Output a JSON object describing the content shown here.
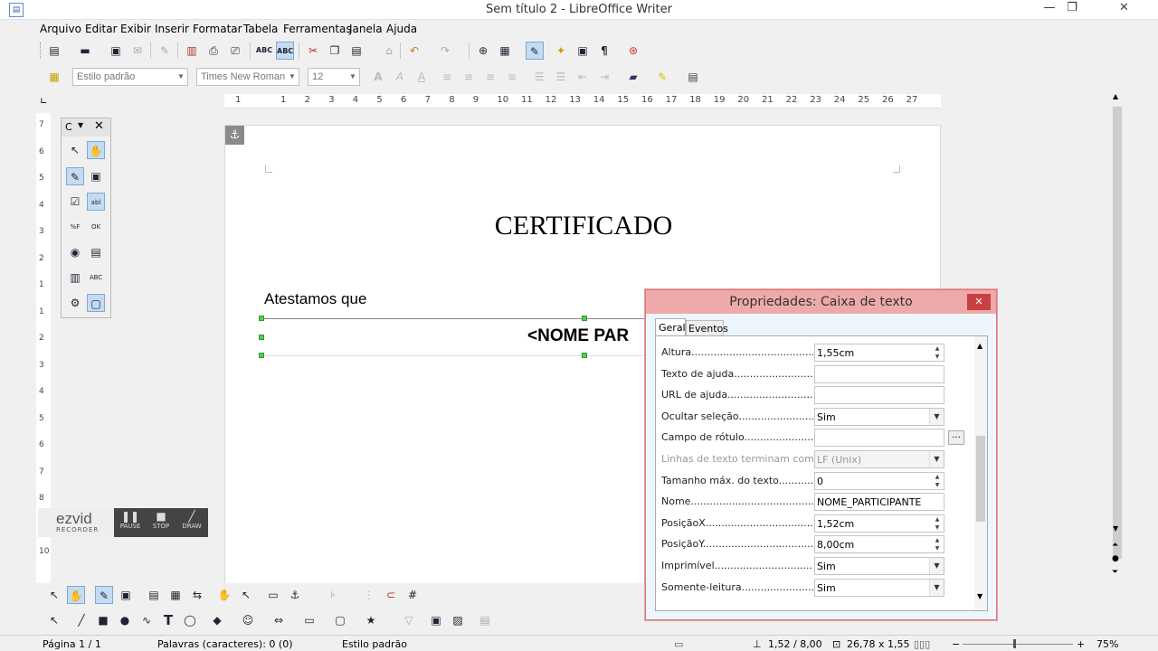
{
  "window": {
    "title": "Sem título 2 - LibreOffice Writer",
    "minimize": "—",
    "restore": "❐",
    "close": "✕"
  },
  "menu": [
    "Arquivo",
    "Editar",
    "Exibir",
    "Inserir",
    "Formatar",
    "Tabela",
    "Ferramentas",
    "Janela",
    "Ajuda"
  ],
  "formatting": {
    "paragraph_style": "Estilo padrão",
    "font_name": "Times New Roman",
    "font_size": "12"
  },
  "ruler": {
    "marks": [
      "1",
      "1",
      "2",
      "3",
      "4",
      "5",
      "6",
      "7",
      "8",
      "9",
      "10",
      "11",
      "12",
      "13",
      "14",
      "15",
      "16",
      "17",
      "18",
      "19",
      "20",
      "21",
      "22",
      "23",
      "24",
      "25",
      "26",
      "27"
    ]
  },
  "vruler": {
    "marks": [
      "7",
      "6",
      "5",
      "4",
      "3",
      "2",
      "1",
      "1",
      "2",
      "3",
      "4",
      "5",
      "6",
      "7",
      "8",
      "9",
      "10"
    ]
  },
  "controls_toolbar": {
    "title": "C"
  },
  "document": {
    "heading": "CERTIFICADO",
    "line1": "Atestamos que",
    "textbox": "<NOME PAR"
  },
  "ezvid": {
    "brand": "ezvid",
    "sub": "RECORDER",
    "pause": "PAUSE",
    "stop": "STOP",
    "draw": "DRAW"
  },
  "dialog": {
    "title": "Propriedades: Caixa de texto",
    "tabs": [
      "Geral",
      "Eventos"
    ],
    "rows": [
      {
        "label": "Altura...............................................",
        "value": "1,55cm",
        "kind": "spin"
      },
      {
        "label": "Texto de ajuda.....................................",
        "value": "",
        "kind": "text"
      },
      {
        "label": "URL de ajuda.......................................",
        "value": "",
        "kind": "text"
      },
      {
        "label": "Ocultar seleção......................................",
        "value": "Sim",
        "kind": "drop"
      },
      {
        "label": "Campo de rótulo.....................................",
        "value": "",
        "kind": "button",
        "button": "..."
      },
      {
        "label": "Linhas de texto terminam com.....",
        "value": "LF (Unix)",
        "kind": "drop",
        "disabled": true
      },
      {
        "label": "Tamanho máx. do texto.............",
        "value": "0",
        "kind": "spin"
      },
      {
        "label": "Nome.................................................",
        "value": "NOME_PARTICIPANTE",
        "kind": "text"
      },
      {
        "label": "PosiçãoX.............................................",
        "value": "1,52cm",
        "kind": "spin"
      },
      {
        "label": "PosiçãoY.............................................",
        "value": "8,00cm",
        "kind": "spin"
      },
      {
        "label": "Imprimível............................................",
        "value": "Sim",
        "kind": "drop"
      },
      {
        "label": "Somente-leitura.....................................",
        "value": "Sim",
        "kind": "drop"
      }
    ]
  },
  "status": {
    "page": "Página 1 / 1",
    "words": "Palavras (caracteres): 0 (0)",
    "style": "Estilo padrão",
    "position": "1,52 / 8,00",
    "size": "26,78 x 1,55",
    "zoom": "75%"
  }
}
